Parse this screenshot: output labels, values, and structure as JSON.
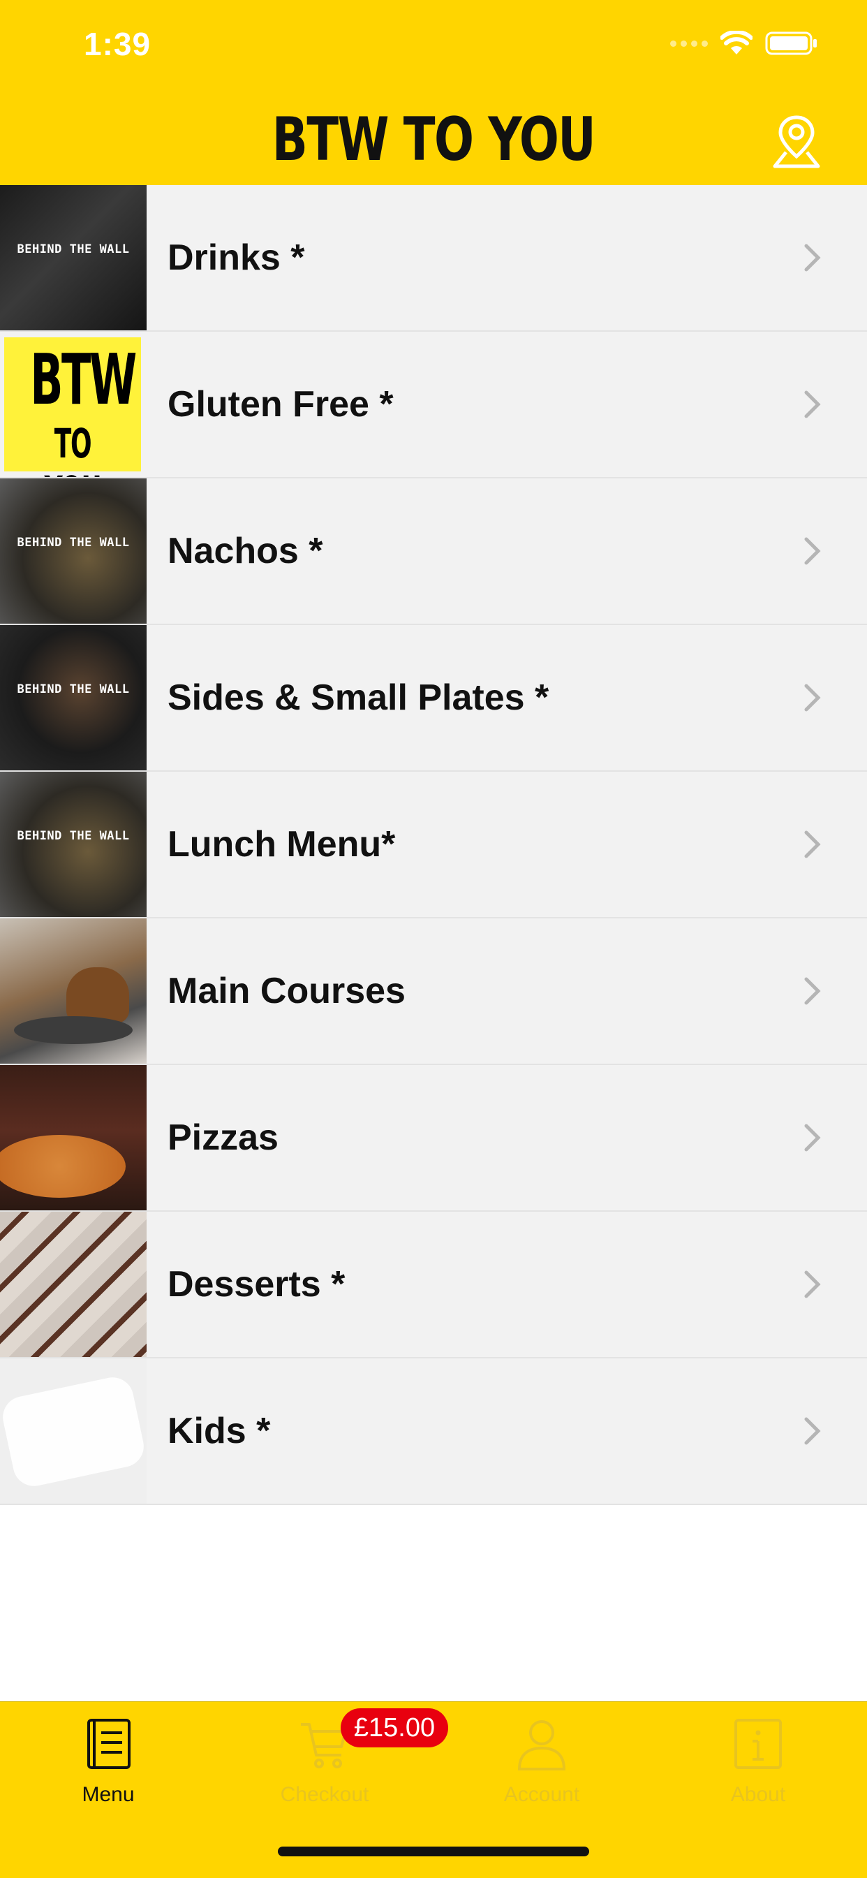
{
  "status_bar": {
    "time": "1:39"
  },
  "header": {
    "title": "BTW TO YOU",
    "map_icon": "map-pin-icon"
  },
  "menu": {
    "items": [
      {
        "label": "Drinks *"
      },
      {
        "label": "Gluten Free *"
      },
      {
        "label": "Nachos *"
      },
      {
        "label": "Sides & Small Plates *"
      },
      {
        "label": "Lunch Menu*"
      },
      {
        "label": "Main Courses"
      },
      {
        "label": "Pizzas"
      },
      {
        "label": "Desserts *"
      },
      {
        "label": "Kids *"
      }
    ]
  },
  "thumb_texts": {
    "brand_line": "BEHIND THE WALL",
    "logo_top": "BTW",
    "logo_bottom": "TO YOU"
  },
  "tab_bar": {
    "menu": "Menu",
    "checkout": "Checkout",
    "account": "Account",
    "about": "About",
    "cart_badge": "£15.00"
  },
  "colors": {
    "brand_yellow": "#FFD500",
    "badge_red": "#e8000f",
    "row_bg": "#f2f2f2"
  }
}
